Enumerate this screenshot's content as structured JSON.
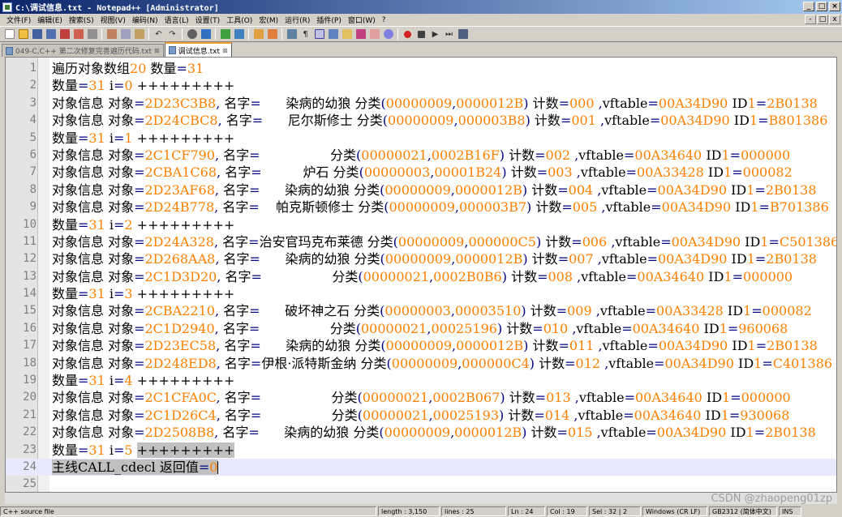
{
  "window": {
    "title": "C:\\调试信息.txt - Notepad++ [Administrator]",
    "buttons": [
      "_",
      "□",
      "×"
    ]
  },
  "menu": [
    "文件(F)",
    "编辑(E)",
    "搜索(S)",
    "视图(V)",
    "编码(N)",
    "语言(L)",
    "设置(T)",
    "工具(O)",
    "宏(M)",
    "运行(R)",
    "插件(P)",
    "窗口(W)",
    "?"
  ],
  "mdi_buttons": [
    "-",
    "□",
    "x"
  ],
  "tabs": [
    {
      "label": "049-C,C++ 第二次修复完善遍历代码.txt",
      "active": false
    },
    {
      "label": "调试信息.txt",
      "active": true
    }
  ],
  "editor": {
    "lines": [
      "遍历对象数组20 数量=31",
      "数量=31 i=0 +++++++++",
      "对象信息 对象=2D23C3B8, 名字=      染病的幼狼 分类(00000009,0000012B) 计数=000 ,vftable=00A34D90 ID1=2B0138",
      "对象信息 对象=2D24CBC8, 名字=      尼尔斯修士 分类(00000009,000003B8) 计数=001 ,vftable=00A34D90 ID1=B801386",
      "数量=31 i=1 +++++++++",
      "对象信息 对象=2C1CF790, 名字=                 分类(00000021,0002B16F) 计数=002 ,vftable=00A34640 ID1=000000",
      "对象信息 对象=2CBA1C68, 名字=          炉石 分类(00000003,00001B24) 计数=003 ,vftable=00A33428 ID1=000082",
      "对象信息 对象=2D23AF68, 名字=      染病的幼狼 分类(00000009,0000012B) 计数=004 ,vftable=00A34D90 ID1=2B0138",
      "对象信息 对象=2D24B778, 名字=    帕克斯顿修士 分类(00000009,000003B7) 计数=005 ,vftable=00A34D90 ID1=B701386",
      "数量=31 i=2 +++++++++",
      "对象信息 对象=2D24A328, 名字=治安官玛克布莱德 分类(00000009,000000C5) 计数=006 ,vftable=00A34D90 ID1=C501386",
      "对象信息 对象=2D268AA8, 名字=      染病的幼狼 分类(00000009,0000012B) 计数=007 ,vftable=00A34D90 ID1=2B0138",
      "对象信息 对象=2C1D3D20, 名字=                 分类(00000021,0002B0B6) 计数=008 ,vftable=00A34640 ID1=000000",
      "数量=31 i=3 +++++++++",
      "对象信息 对象=2CBA2210, 名字=      破坏神之石 分类(00000003,00003510) 计数=009 ,vftable=00A33428 ID1=000082",
      "对象信息 对象=2C1D2940, 名字=                 分类(00000021,00025196) 计数=010 ,vftable=00A34640 ID1=960068",
      "对象信息 对象=2D23EC58, 名字=      染病的幼狼 分类(00000009,0000012B) 计数=011 ,vftable=00A34D90 ID1=2B0138",
      "对象信息 对象=2D248ED8, 名字=伊根·派特斯金纳 分类(00000009,000000C4) 计数=012 ,vftable=00A34D90 ID1=C401386",
      "数量=31 i=4 +++++++++",
      "对象信息 对象=2C1CFA0C, 名字=                 分类(00000021,0002B067) 计数=013 ,vftable=00A34640 ID1=000000",
      "对象信息 对象=2C1D26C4, 名字=                 分类(00000021,00025193) 计数=014 ,vftable=00A34640 ID1=930068",
      "对象信息 对象=2D2508B8, 名字=      染病的幼狼 分类(00000009,0000012B) 计数=015 ,vftable=00A34D90 ID1=2B0138",
      "数量=31 i=5 +++++++++",
      "主线CALL_cdecl 返回值=0",
      ""
    ],
    "current_line": 24
  },
  "watermark": "CSDN @zhaopeng01zp",
  "status": {
    "type": "C++ source file",
    "length": "length : 3,150",
    "lines": "lines : 25",
    "ln": "Ln : 24",
    "col": "Col : 19",
    "sel": "Sel : 32 | 2",
    "eol": "Windows (CR LF)",
    "encoding": "GB2312 (简体中文)",
    "mode": "INS"
  },
  "colors": {
    "number": "#ff8000",
    "operator": "#000080",
    "title_bar_start": "#0a246a",
    "tab_active_accent": "#f0a030"
  }
}
